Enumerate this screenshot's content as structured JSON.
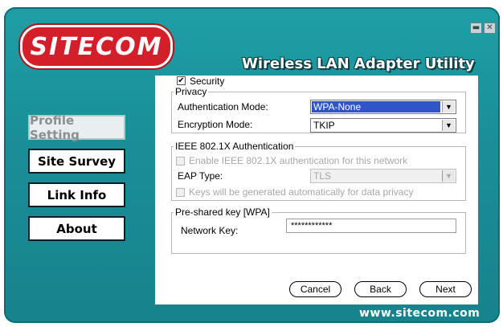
{
  "app": {
    "logo_text": "SITECOM",
    "title": "Wireless LAN Adapter Utility",
    "footer_url": "www.sitecom.com",
    "window_controls": {
      "minimize_icon": "minimize-icon",
      "close_icon": "close-icon",
      "minimize_glyph": "▬",
      "close_glyph": "✕"
    }
  },
  "nav": {
    "items": [
      {
        "label": "Profile Setting",
        "active": true
      },
      {
        "label": "Site Survey",
        "active": false
      },
      {
        "label": "Link Info",
        "active": false
      },
      {
        "label": "About",
        "active": false
      }
    ]
  },
  "security": {
    "checkbox_label": "Security",
    "checked": true,
    "check_glyph": "✔"
  },
  "privacy": {
    "legend": "Privacy",
    "auth_mode_label": "Authentication Mode:",
    "auth_mode_value": "WPA-None",
    "enc_mode_label": "Encryption Mode:",
    "enc_mode_value": "TKIP",
    "arrow_glyph": "▼"
  },
  "ieee": {
    "legend": "IEEE 802.1X Authentication",
    "enable_label": "Enable IEEE 802.1X authentication for this network",
    "eap_label": "EAP Type:",
    "eap_value": "TLS",
    "keys_label": "Keys will be generated automatically for data privacy"
  },
  "psk": {
    "legend": "Pre-shared key [WPA]",
    "network_key_label": "Network Key:",
    "network_key_value": "************"
  },
  "buttons": {
    "cancel": "Cancel",
    "back": "Back",
    "next": "Next"
  },
  "colors": {
    "window_bg": "#1a8f98",
    "logo_red": "#d21f29",
    "selection_blue": "#2f55c9"
  }
}
